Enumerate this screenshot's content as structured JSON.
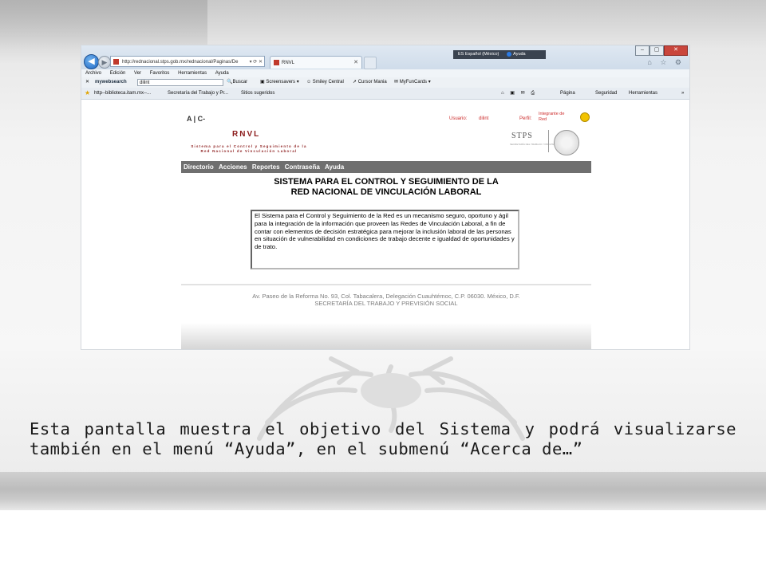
{
  "caption": "Esta pantalla muestra el objetivo del Sistema y podrá visualizarse también en el menú “Ayuda”, en el submenú “Acerca de…”",
  "browser": {
    "address": "http://rednacional.stps.gob.mx/rednacional/Paginas/De",
    "tab_title": "RNVL",
    "language_bar": "ES Español (México)",
    "language_help": "Ayuda",
    "win_min": "–",
    "win_max": "▢",
    "win_close": "✕",
    "right_icons": "⌂ ☆ ⚙",
    "menu": [
      "Archivo",
      "Edición",
      "Ver",
      "Favoritos",
      "Herramientas",
      "Ayuda"
    ],
    "toolbar": {
      "close": "✕",
      "mywebsearch": "mywebsearch",
      "search_value": "dilint",
      "search_button": "Buscar",
      "screensavers": "Screensavers",
      "smiley": "Smiley Central",
      "cursor": "Cursor Mania",
      "myfuncards": "MyFunCards"
    },
    "favorites": {
      "item1": "http--biblioteca.itam.mx--...",
      "item2": "Secretaría del Trabajo y Pr...",
      "item3": "Sitios sugeridos",
      "pagina": "Página",
      "seguridad": "Seguridad",
      "herramientas": "Herramientas",
      "more": "»"
    }
  },
  "page": {
    "font_controls": "A  |  C-",
    "user_label": "Usuario:",
    "user_value": "dilint",
    "perfil_label": "Perfil:",
    "perfil_value": "Integrante de Red",
    "logo_title": "RNVL",
    "logo_subtitle": "Sistema para el Control y Seguimiento de la Red Nacional de Vinculación Laboral",
    "stps": "STPS",
    "stps_sub": "SECRETARÍA DEL TRABAJO Y PREVISIÓN SOCIAL",
    "nav": [
      "Directorio",
      "Acciones",
      "Reportes",
      "Contraseña",
      "Ayuda"
    ],
    "title_line1": "SISTEMA PARA EL CONTROL Y SEGUIMIENTO DE LA",
    "title_line2": "RED NACIONAL DE VINCULACIÓN LABORAL",
    "description": "El Sistema para el Control y Seguimiento de la Red es un mecanismo seguro, oportuno y ágil para la integración de la información que proveen las Redes de Vinculación Laboral, a fin de contar con elementos de decisión estratégica para mejorar la inclusión laboral de las personas en situación de vulnerabilidad en condiciones de trabajo decente e igualdad de oportunidades y de trato.",
    "footer_line1": "Av. Paseo de la Reforma No. 93, Col. Tabacalera, Delegación Cuauhtémoc, C.P. 06030. México, D.F.",
    "footer_line2": "SECRETARÍA DEL TRABAJO Y PREVISIÓN SOCIAL"
  },
  "colors": {
    "accent_red": "#8b1a1a",
    "nav_gray": "#6f6f6f",
    "user_red": "#cc2b2b"
  }
}
